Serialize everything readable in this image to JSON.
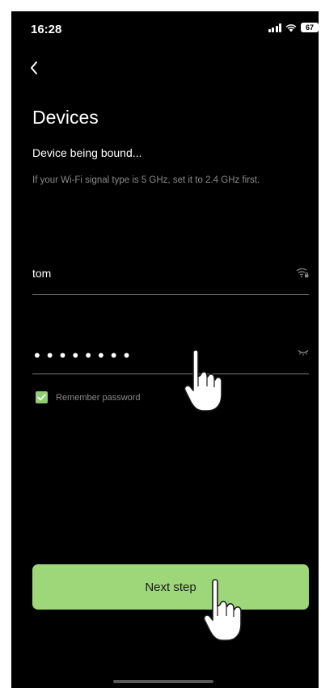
{
  "status_bar": {
    "time": "16:28",
    "battery": "67"
  },
  "header": {
    "title": "Devices"
  },
  "content": {
    "subtitle": "Device being bound...",
    "hint": "If your Wi-Fi signal type is 5 GHz, set it to 2.4 GHz first."
  },
  "wifi_form": {
    "ssid_value": "tom",
    "password_masked": "••••••••",
    "remember_label": "Remember password",
    "remember_checked": true
  },
  "actions": {
    "next_label": "Next step"
  },
  "colors": {
    "background": "#000000",
    "accent": "#9ed67a",
    "checkbox": "#8fce72",
    "muted_text": "#8a8a8a",
    "underline": "#7a7a7a"
  },
  "icons": {
    "back": "chevron-left-icon",
    "wifi": "wifi-lock-icon",
    "eye": "eye-closed-icon",
    "pointer": "hand-pointer-icon"
  }
}
